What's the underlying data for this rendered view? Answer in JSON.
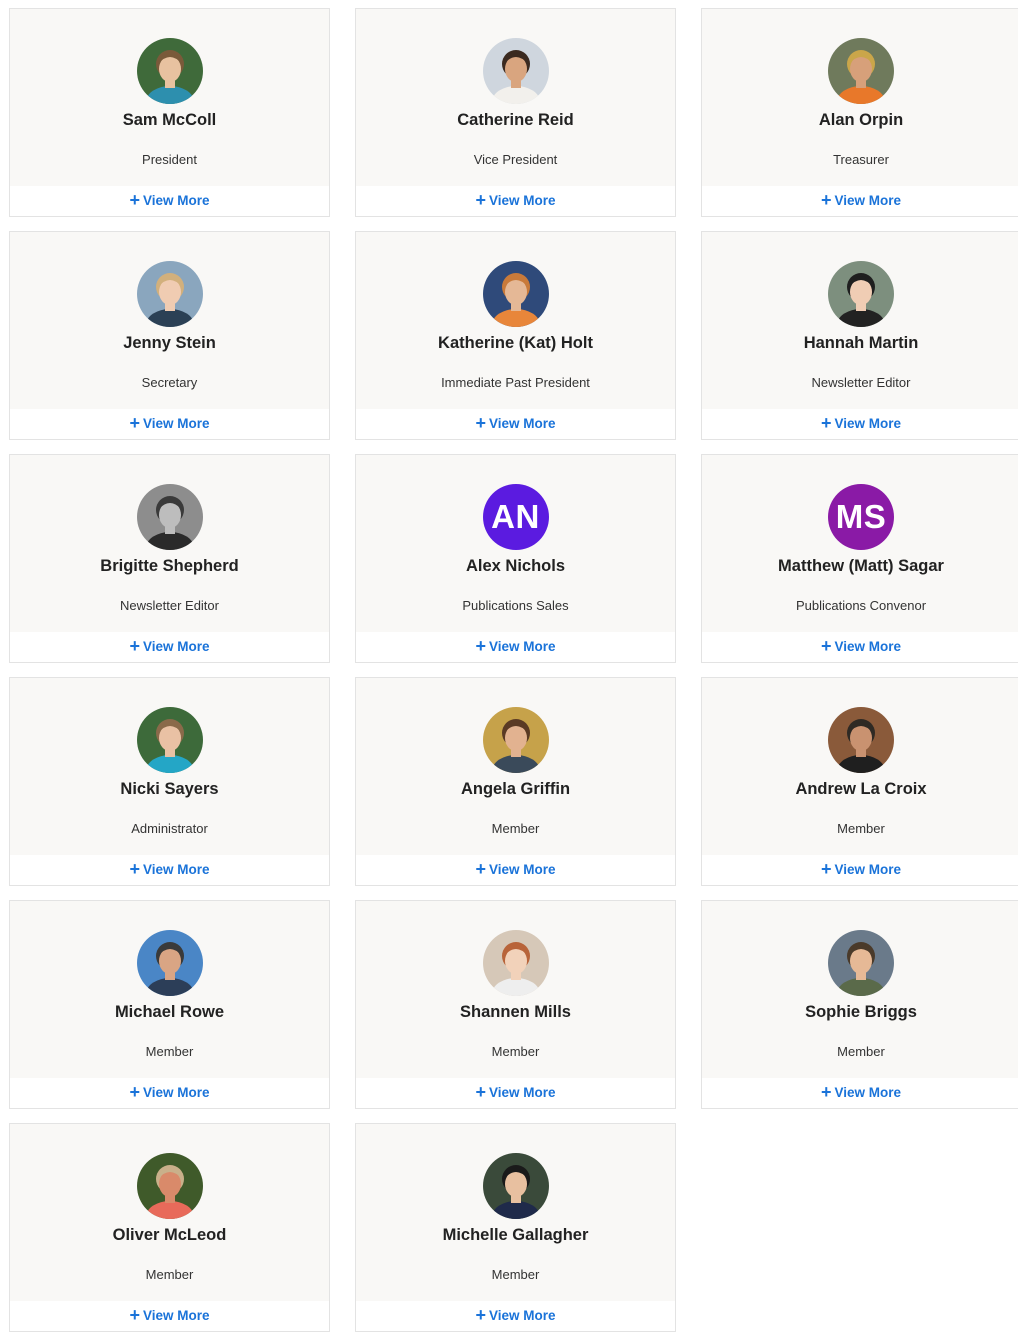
{
  "view_more_label": "View More",
  "view_more_icon": "+",
  "colors": {
    "link": "#1a73d9",
    "card_top": "#f9f8f6",
    "border": "#e3e3e3"
  },
  "members": [
    {
      "name": "Sam McColl",
      "role": "President",
      "avatar": {
        "type": "photo",
        "skin": "#e8c2a0",
        "hair": "#7a5a3a",
        "shirt": "#2d8fae",
        "bg": "#3f6a3a"
      }
    },
    {
      "name": "Catherine Reid",
      "role": "Vice President",
      "avatar": {
        "type": "photo",
        "skin": "#d9a57f",
        "hair": "#3b2a20",
        "shirt": "#f2f0ec",
        "bg": "#cfd6de"
      }
    },
    {
      "name": "Alan Orpin",
      "role": "Treasurer",
      "avatar": {
        "type": "photo",
        "skin": "#d7a07a",
        "hair": "#caa64a",
        "shirt": "#e8782a",
        "bg": "#6f7a5c"
      }
    },
    {
      "name": "Jenny Stein",
      "role": "Secretary",
      "avatar": {
        "type": "photo",
        "skin": "#f0ccb2",
        "hair": "#d2b07c",
        "shirt": "#2b4055",
        "bg": "#8aa6be"
      }
    },
    {
      "name": "Katherine (Kat) Holt",
      "role": "Immediate Past President",
      "avatar": {
        "type": "photo",
        "skin": "#e5b896",
        "hair": "#c97a3a",
        "shirt": "#e8863a",
        "bg": "#2f4a7a"
      }
    },
    {
      "name": "Hannah Martin",
      "role": "Newsletter Editor",
      "avatar": {
        "type": "photo",
        "skin": "#f0cdb4",
        "hair": "#1f1f1f",
        "shirt": "#222222",
        "bg": "#7d8f7e"
      }
    },
    {
      "name": "Brigitte Shepherd",
      "role": "Newsletter Editor",
      "avatar": {
        "type": "photo",
        "skin": "#bdbdbd",
        "hair": "#3a3a3a",
        "shirt": "#2a2a2a",
        "bg": "#8d8d8d"
      }
    },
    {
      "name": "Alex Nichols",
      "role": "Publications Sales",
      "avatar": {
        "type": "initials",
        "initials": "AN",
        "color": "#5b1be0"
      }
    },
    {
      "name": "Matthew (Matt) Sagar",
      "role": "Publications Convenor",
      "avatar": {
        "type": "initials",
        "initials": "MS",
        "color": "#8a1aa6"
      }
    },
    {
      "name": "Nicki Sayers",
      "role": "Administrator",
      "avatar": {
        "type": "photo",
        "skin": "#e9c1a4",
        "hair": "#8a6a4a",
        "shirt": "#24a6c6",
        "bg": "#3d6a3a"
      }
    },
    {
      "name": "Angela Griffin",
      "role": "Member",
      "avatar": {
        "type": "photo",
        "skin": "#e2b290",
        "hair": "#5a3a24",
        "shirt": "#3a4a5a",
        "bg": "#c6a24a"
      }
    },
    {
      "name": "Andrew La Croix",
      "role": "Member",
      "avatar": {
        "type": "photo",
        "skin": "#c99270",
        "hair": "#2f2a24",
        "shirt": "#1f1f1f",
        "bg": "#8a5a3a"
      }
    },
    {
      "name": "Michael Rowe",
      "role": "Member",
      "avatar": {
        "type": "photo",
        "skin": "#d9a584",
        "hair": "#3a3a3a",
        "shirt": "#2c3e58",
        "bg": "#4a86c6"
      }
    },
    {
      "name": "Shannen Mills",
      "role": "Member",
      "avatar": {
        "type": "photo",
        "skin": "#f2d2ba",
        "hair": "#b8643a",
        "shirt": "#eeeeee",
        "bg": "#d6c8b8"
      }
    },
    {
      "name": "Sophie Briggs",
      "role": "Member",
      "avatar": {
        "type": "photo",
        "skin": "#e6b996",
        "hair": "#4a3a2a",
        "shirt": "#5a6a4a",
        "bg": "#6a7a8a"
      }
    },
    {
      "name": "Oliver McLeod",
      "role": "Member",
      "avatar": {
        "type": "photo",
        "skin": "#d98a6a",
        "hair": "#c9b08a",
        "shirt": "#e86a5a",
        "bg": "#3f5a2a"
      }
    },
    {
      "name": "Michelle Gallagher",
      "role": "Member",
      "avatar": {
        "type": "photo",
        "skin": "#e8c0a0",
        "hair": "#1a1a1a",
        "shirt": "#1f2a4a",
        "bg": "#3a4a3a"
      }
    }
  ]
}
